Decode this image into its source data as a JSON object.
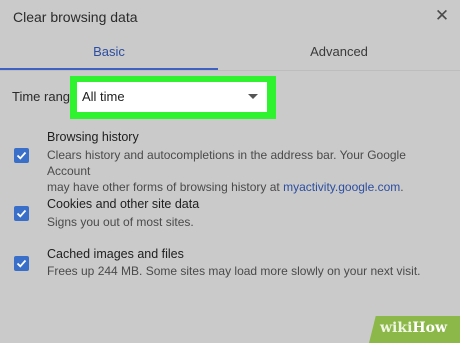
{
  "dialog": {
    "title": "Clear browsing data",
    "close_icon": "close-icon"
  },
  "tabs": [
    {
      "label": "Basic",
      "active": true
    },
    {
      "label": "Advanced",
      "active": false
    }
  ],
  "time_range": {
    "label": "Time range",
    "selected": "All time"
  },
  "items": [
    {
      "title": "Browsing history",
      "description_line1": "Clears history and autocompletions in the address bar. Your Google Account",
      "description_line2": "may have other forms of browsing history at ",
      "link": "myactivity.google.com",
      "link_suffix": ".",
      "checked": true
    },
    {
      "title": "Cookies and other site data",
      "description": "Signs you out of most sites.",
      "checked": true
    },
    {
      "title": "Cached images and files",
      "description": "Frees up 244 MB. Some sites may load more slowly on your next visit.",
      "checked": true
    }
  ],
  "watermark": {
    "wiki": "wiki",
    "how": "How"
  },
  "colors": {
    "accent": "#3e62c4",
    "checkbox": "#3a6fc9",
    "highlight": "#2ff32f",
    "background": "#cacaca",
    "watermark": "#8cb84a"
  }
}
